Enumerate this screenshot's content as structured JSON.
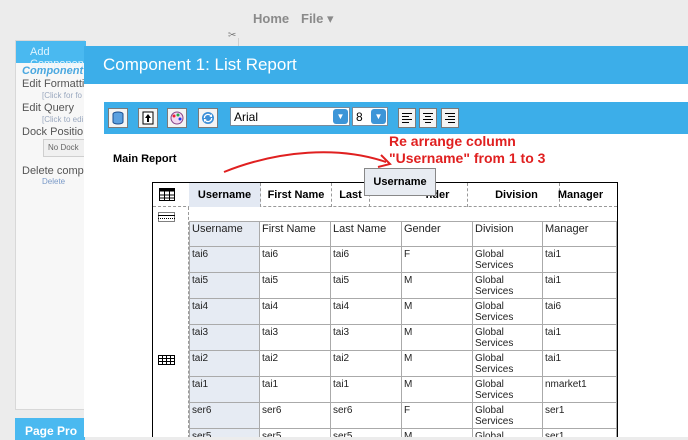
{
  "topnav": {
    "home": "Home",
    "file": "File ▾"
  },
  "left_panel": {
    "header": "Add Component",
    "title": "Component",
    "edit_formatting": "Edit Formatti",
    "edit_formatting_hint": "[Click for fo",
    "edit_query": "Edit Query",
    "edit_query_hint": "[Click to edi",
    "dock_position": "Dock Positio",
    "dock_value": "No Dock",
    "delete_component": "Delete comp",
    "delete_link": "Delete",
    "bottom_header": "Page Pro"
  },
  "window": {
    "title": "Component 1: List Report",
    "font_name": "Arial",
    "font_size": "8"
  },
  "report": {
    "section_label": "Main Report",
    "annotation_line1": "Re arrange column",
    "annotation_line2": "\"Username\" from 1 to 3",
    "drag_ghost": "Username",
    "header": [
      "Username",
      "First Name",
      "Last",
      "nder",
      "Division",
      "Manager"
    ],
    "columns": [
      "Username",
      "First Name",
      "Last Name",
      "Gender",
      "Division",
      "Manager"
    ],
    "rows": [
      [
        "tai6",
        "tai6",
        "tai6",
        "F",
        "Global Services",
        "tai1"
      ],
      [
        "tai5",
        "tai5",
        "tai5",
        "M",
        "Global Services",
        "tai1"
      ],
      [
        "tai4",
        "tai4",
        "tai4",
        "M",
        "Global Services",
        "tai6"
      ],
      [
        "tai3",
        "tai3",
        "tai3",
        "M",
        "Global Services",
        "tai1"
      ],
      [
        "tai2",
        "tai2",
        "tai2",
        "M",
        "Global Services",
        "tai1"
      ],
      [
        "tai1",
        "tai1",
        "tai1",
        "M",
        "Global Services",
        "nmarket1"
      ],
      [
        "ser6",
        "ser6",
        "ser6",
        "F",
        "Global Services",
        "ser1"
      ],
      [
        "ser5",
        "ser5",
        "ser5",
        "M",
        "Global",
        "ser1"
      ]
    ]
  },
  "colors": {
    "accent": "#3caee9",
    "annotation": "#e02020",
    "selection": "#e6ebf3"
  }
}
